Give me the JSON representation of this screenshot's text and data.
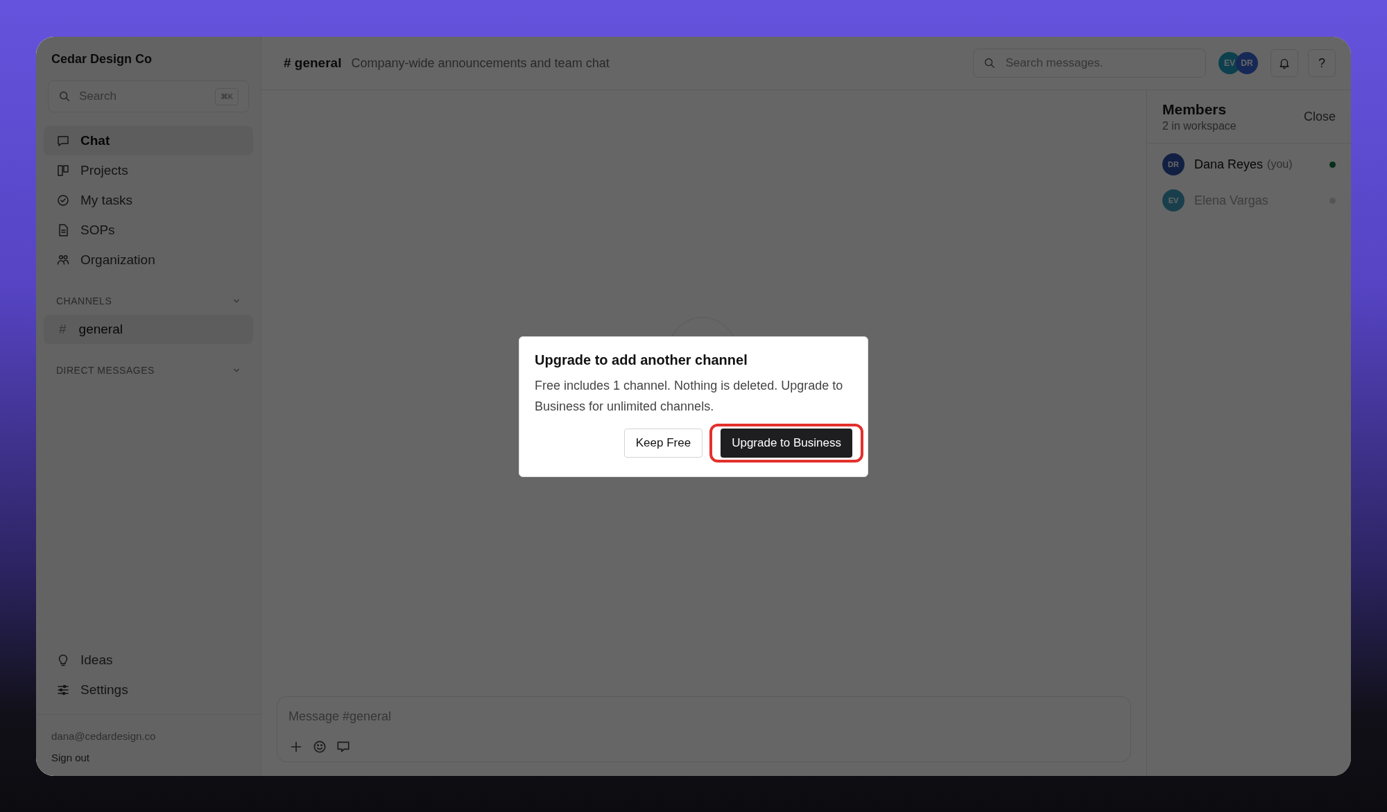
{
  "workspace": {
    "name": "Cedar Design Co"
  },
  "sidebar": {
    "search": {
      "placeholder": "Search",
      "shortcut": "⌘K"
    },
    "nav": [
      {
        "label": "Chat",
        "selected": true
      },
      {
        "label": "Projects",
        "selected": false
      },
      {
        "label": "My tasks",
        "selected": false
      },
      {
        "label": "SOPs",
        "selected": false
      },
      {
        "label": "Organization",
        "selected": false
      }
    ],
    "channels": {
      "title": "CHANNELS",
      "expanded": true,
      "items": [
        {
          "prefix": "#",
          "label": "general",
          "selected": true
        }
      ]
    },
    "direct_messages": {
      "title": "DIRECT MESSAGES",
      "expanded": true
    },
    "bottom_nav": [
      {
        "label": "Ideas",
        "selected": false
      },
      {
        "label": "Settings",
        "selected": false
      }
    ],
    "account": {
      "email": "dana@cedardesign.co",
      "sign_out": "Sign out"
    }
  },
  "header": {
    "channel_prefix": "#",
    "channel": "general",
    "description": "Company-wide announcements and team chat",
    "search": {
      "placeholder": "Search messages."
    },
    "avatars": [
      {
        "initials": "EV"
      },
      {
        "initials": "DR"
      }
    ],
    "help": "?"
  },
  "composer": {
    "placeholder": "Message #general"
  },
  "members": {
    "title": "Members",
    "subtitle": "2 in workspace",
    "close": "Close",
    "items": [
      {
        "initials": "DR",
        "name": "Dana Reyes",
        "note": "(you)",
        "online": true
      },
      {
        "initials": "EV",
        "name": "Elena Vargas",
        "online": false
      }
    ]
  },
  "dialog": {
    "title": "Upgrade to add another channel",
    "body": "Free includes 1 channel. Nothing is deleted. Upgrade to Business for unlimited channels.",
    "buttons": [
      {
        "label": "Keep Free",
        "kind": "secondary",
        "highlighted": false
      },
      {
        "label": "Upgrade to Business",
        "kind": "primary",
        "highlighted": true
      }
    ]
  }
}
